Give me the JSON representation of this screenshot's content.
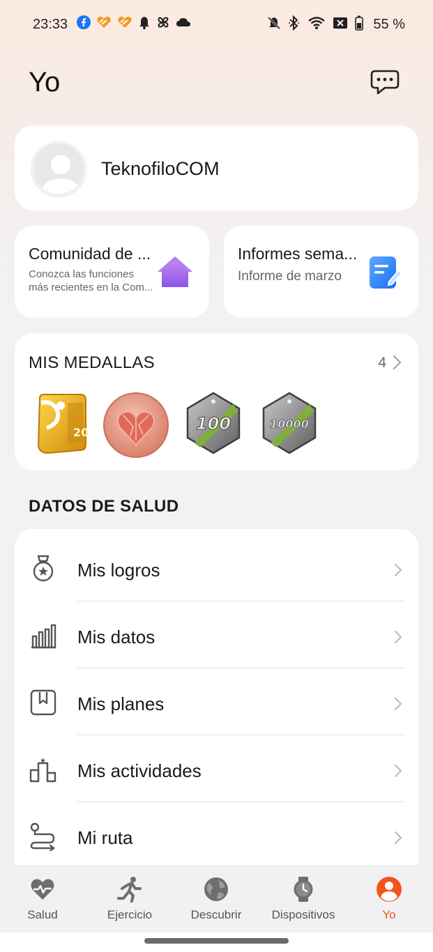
{
  "status_bar": {
    "time": "23:33",
    "left_icons": [
      "facebook-icon",
      "app-heart-icon",
      "app-heart-icon",
      "bell-icon",
      "pinwheel-icon",
      "cloud-icon"
    ],
    "right_icons": [
      "mute-icon",
      "bluetooth-icon",
      "wifi-icon",
      "sim-off-icon",
      "battery-icon"
    ],
    "battery": "55 %"
  },
  "header": {
    "title": "Yo",
    "chat_icon": "chat-bubble-icon"
  },
  "profile": {
    "username": "TeknofiloCOM"
  },
  "community_card": {
    "title": "Comunidad de ...",
    "subtitle_line1": "Conozca las funciones",
    "subtitle_line2": "más recientes en la Com...",
    "icon": "house-icon"
  },
  "reports_card": {
    "title": "Informes sema...",
    "subtitle": "Informe de marzo",
    "icon": "report-edit-icon"
  },
  "medals": {
    "title": "MIS MEDALLAS",
    "count": "4",
    "badge_icons": [
      "medal-20-icon",
      "medal-heart-icon",
      "medal-100-icon",
      "medal-10000-icon"
    ],
    "badge_text": [
      "20",
      "100",
      "10000"
    ]
  },
  "health_section": {
    "title": "DATOS DE SALUD",
    "items": [
      {
        "label": "Mis logros",
        "icon": "achievement-medal-icon"
      },
      {
        "label": "Mis datos",
        "icon": "bar-chart-icon"
      },
      {
        "label": "Mis planes",
        "icon": "plan-bookmark-icon"
      },
      {
        "label": "Mis actividades",
        "icon": "podium-icon"
      },
      {
        "label": "Mi ruta",
        "icon": "route-icon"
      }
    ]
  },
  "tabbar": {
    "tabs": [
      {
        "label": "Salud",
        "icon": "heart-pulse-icon"
      },
      {
        "label": "Ejercicio",
        "icon": "running-icon"
      },
      {
        "label": "Descubrir",
        "icon": "globe-icon"
      },
      {
        "label": "Dispositivos",
        "icon": "watch-icon"
      },
      {
        "label": "Yo",
        "icon": "profile-icon"
      }
    ],
    "active_color": "#f2541b"
  }
}
